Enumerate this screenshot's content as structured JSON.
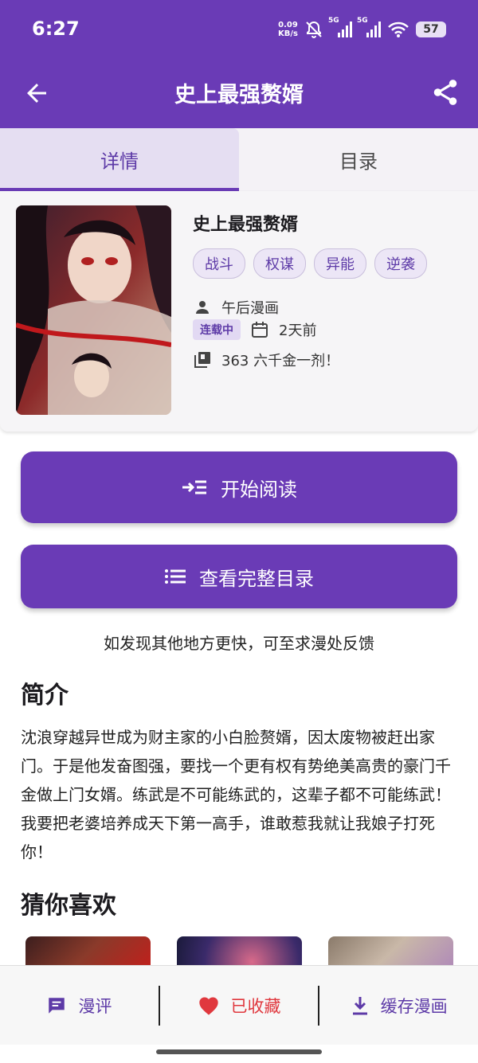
{
  "status_bar": {
    "time": "6:27",
    "net_speed_value": "0.09",
    "net_speed_unit": "KB/s",
    "sim1": "5G",
    "sim2": "5G",
    "battery": "57"
  },
  "app_bar": {
    "title": "史上最强赘婿"
  },
  "tabs": [
    {
      "label": "详情",
      "active": true
    },
    {
      "label": "目录",
      "active": false
    }
  ],
  "book": {
    "title": "史上最强赘婿",
    "tags": [
      "战斗",
      "权谋",
      "异能",
      "逆袭"
    ],
    "author": "午后漫画",
    "status": "连载中",
    "updated": "2天前",
    "latest_chapter": "363 六千金一剂！"
  },
  "buttons": {
    "start_reading": "开始阅读",
    "view_catalog": "查看完整目录"
  },
  "feedback_text": "如发现其他地方更快，可至求漫处反馈",
  "intro": {
    "heading": "简介",
    "text": "沈浪穿越异世成为财主家的小白脸赘婿，因太废物被赶出家门。于是他发奋图强，要找一个更有权有势绝美高贵的豪门千金做上门女婿。练武是不可能练武的，这辈子都不可能练武！我要把老婆培养成天下第一高手，谁敢惹我就让我娘子打死你！"
  },
  "recommend": {
    "heading": "猜你喜欢"
  },
  "bottom_bar": {
    "comments": "漫评",
    "favorited": "已收藏",
    "download": "缓存漫画"
  },
  "colors": {
    "primary": "#6a3bb6",
    "favorite": "#e0383e"
  }
}
